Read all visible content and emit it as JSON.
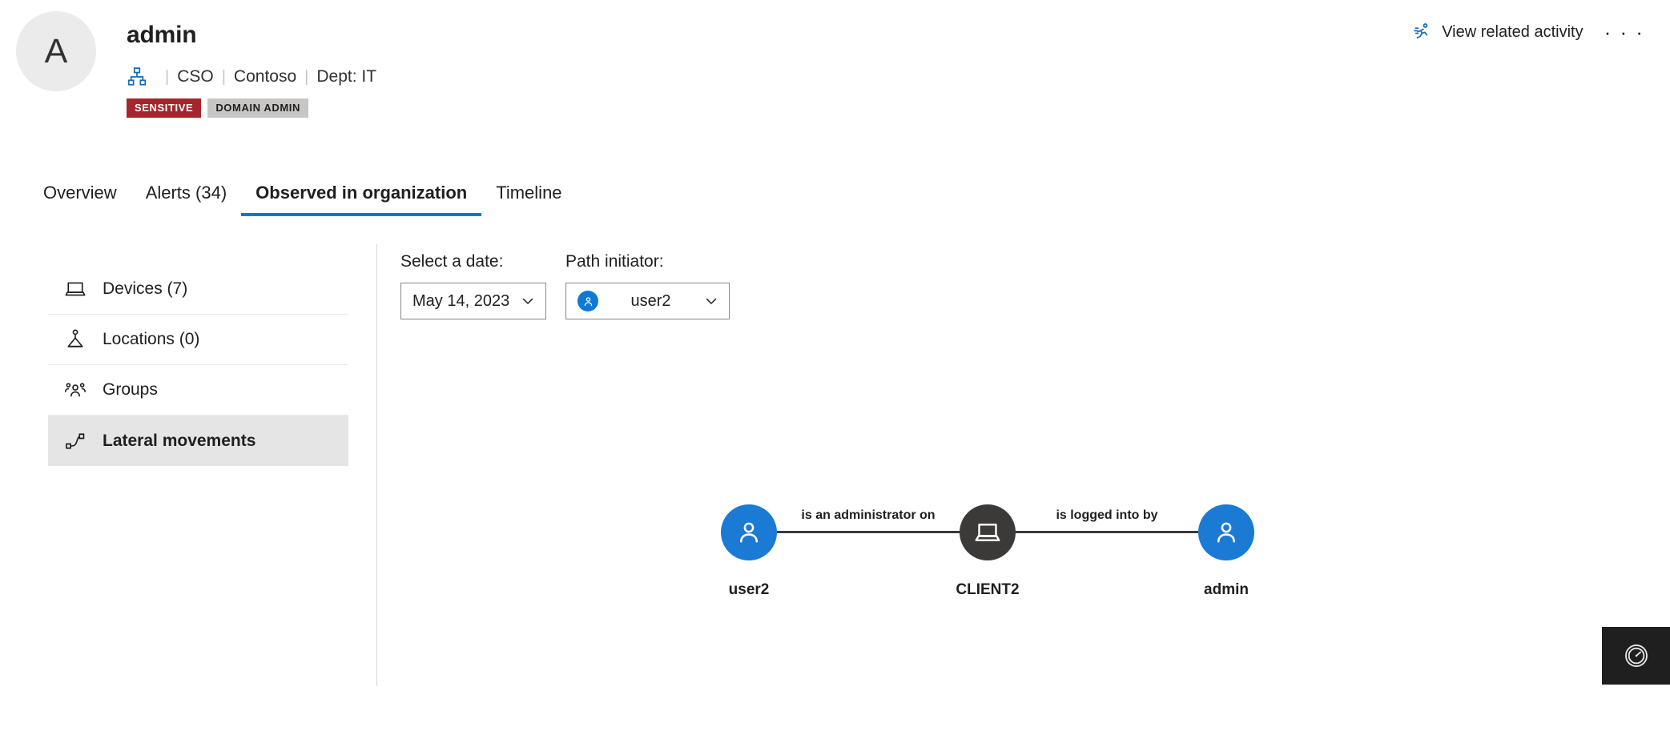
{
  "header": {
    "avatar_initial": "A",
    "title": "admin",
    "org_icon": "org-hierarchy-icon",
    "meta": [
      "CSO",
      "Contoso",
      "Dept: IT"
    ],
    "badges": [
      {
        "label": "SENSITIVE",
        "color": "#a4262c"
      },
      {
        "label": "DOMAIN ADMIN",
        "color": "#c8c6c4"
      }
    ],
    "related_activity_label": "View related activity",
    "related_activity_icon": "running-person-icon",
    "more_actions_label": "· · ·"
  },
  "tabs": [
    {
      "label": "Overview",
      "active": false
    },
    {
      "label": "Alerts (34)",
      "active": false
    },
    {
      "label": "Observed in organization",
      "active": true
    },
    {
      "label": "Timeline",
      "active": false
    }
  ],
  "sidebar": {
    "items": [
      {
        "label": "Devices (7)",
        "icon": "laptop-icon",
        "selected": false
      },
      {
        "label": "Locations (0)",
        "icon": "location-person-icon",
        "selected": false
      },
      {
        "label": "Groups",
        "icon": "people-group-icon",
        "selected": false
      },
      {
        "label": "Lateral movements",
        "icon": "lateral-movement-icon",
        "selected": true
      }
    ]
  },
  "controls": {
    "date": {
      "label": "Select a date:",
      "value": "May 14, 2023",
      "chevron": "chevron-down-icon"
    },
    "path_initiator": {
      "label": "Path initiator:",
      "value": "user2",
      "avatar_icon": "person-icon",
      "chevron": "chevron-down-icon"
    }
  },
  "graph": {
    "nodes": [
      {
        "id": "user2",
        "label": "user2",
        "type": "user",
        "icon": "person-icon",
        "color": "#1a7ad4"
      },
      {
        "id": "client2",
        "label": "CLIENT2",
        "type": "device",
        "icon": "laptop-icon",
        "color": "#3b3a39"
      },
      {
        "id": "admin",
        "label": "admin",
        "type": "user",
        "icon": "person-icon",
        "color": "#1a7ad4"
      }
    ],
    "edges": [
      {
        "from": "user2",
        "to": "client2",
        "label": "is an administrator on"
      },
      {
        "from": "client2",
        "to": "admin",
        "label": "is logged into by"
      }
    ]
  },
  "floating_widget": {
    "icon": "gauge-icon",
    "label": ""
  },
  "theme": {
    "accent": "#0078d4",
    "sensitive": "#a4262c",
    "node_user": "#1a7ad4",
    "node_device": "#3b3a39"
  }
}
